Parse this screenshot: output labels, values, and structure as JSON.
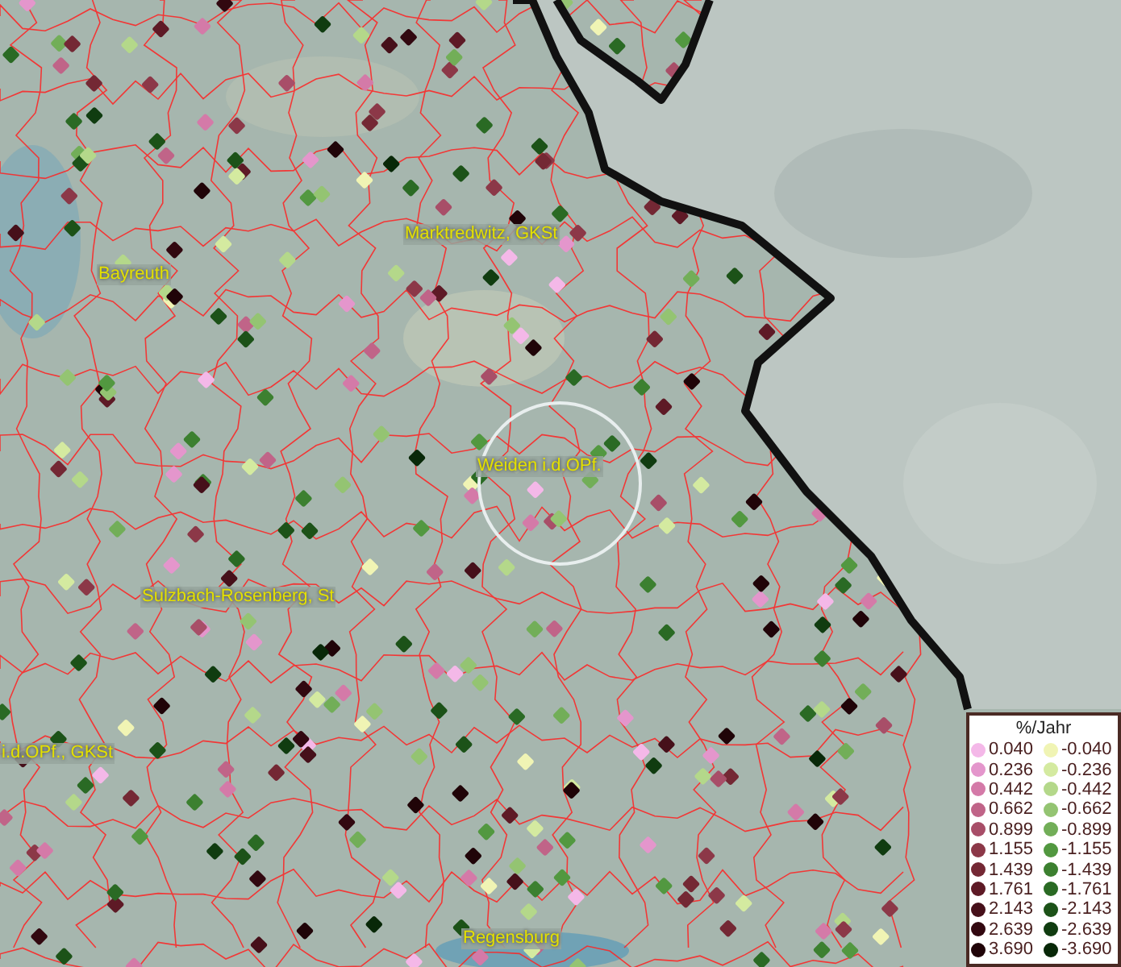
{
  "map": {
    "places": [
      {
        "name": "Marktredwitz, GKSt"
      },
      {
        "name": "Bayreuth"
      },
      {
        "name": "Weiden i.d.OPf."
      },
      {
        "name": "Sulzbach-Rosenberg, St"
      },
      {
        "name": "i.d.OPf., GKSt"
      },
      {
        "name": "Regensburg"
      }
    ]
  },
  "legend": {
    "title": "%/Jahr",
    "positive": [
      {
        "label": "0.040",
        "color": "#f4b8e8"
      },
      {
        "label": "0.236",
        "color": "#e496cc"
      },
      {
        "label": "0.442",
        "color": "#d47aa8"
      },
      {
        "label": "0.662",
        "color": "#c06488"
      },
      {
        "label": "0.899",
        "color": "#a84e68"
      },
      {
        "label": "1.155",
        "color": "#8c3848"
      },
      {
        "label": "1.439",
        "color": "#742834"
      },
      {
        "label": "1.761",
        "color": "#5e1a26"
      },
      {
        "label": "2.143",
        "color": "#46101a"
      },
      {
        "label": "2.639",
        "color": "#320810"
      },
      {
        "label": "3.690",
        "color": "#200408"
      }
    ],
    "negative": [
      {
        "label": "-0.040",
        "color": "#f0f4b4"
      },
      {
        "label": "-0.236",
        "color": "#d4eaa0"
      },
      {
        "label": "-0.442",
        "color": "#b4d88a"
      },
      {
        "label": "-0.662",
        "color": "#94c472"
      },
      {
        "label": "-0.899",
        "color": "#72ae58"
      },
      {
        "label": "-1.155",
        "color": "#529840"
      },
      {
        "label": "-1.439",
        "color": "#3c8030"
      },
      {
        "label": "-1.761",
        "color": "#2a6a24"
      },
      {
        "label": "-2.143",
        "color": "#1c5218"
      },
      {
        "label": "-2.639",
        "color": "#103c10"
      },
      {
        "label": "-3.690",
        "color": "#082808"
      }
    ]
  }
}
